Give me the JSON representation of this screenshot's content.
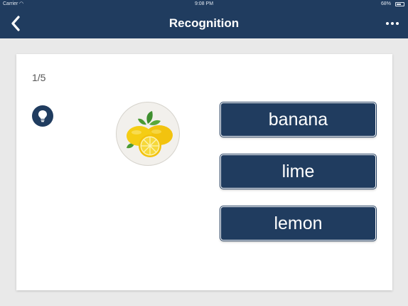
{
  "status_bar": {
    "carrier": "Carrier",
    "time": "9:08 PM",
    "battery": "68%",
    "battery_level": 0.68
  },
  "nav": {
    "title": "Recognition",
    "back_icon": "chevron-left-icon",
    "more_icon": "ellipsis-icon"
  },
  "quiz": {
    "progress": "1/5",
    "hint_icon": "lightbulb-icon",
    "image": "lemons-image",
    "options": [
      {
        "label": "banana"
      },
      {
        "label": "lime"
      },
      {
        "label": "lemon"
      }
    ]
  },
  "colors": {
    "accent": "#203c5f",
    "background": "#e9e9e9",
    "card": "#ffffff"
  }
}
